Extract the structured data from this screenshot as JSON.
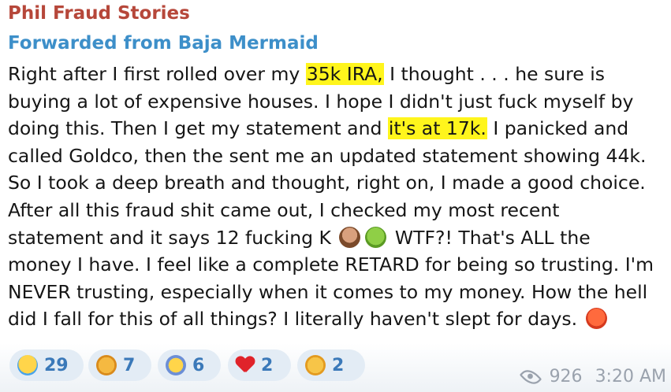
{
  "channel": {
    "name": "Phil Fraud Stories"
  },
  "forwarded_from": "Forwarded from Baja Mermaid",
  "message": {
    "l1_a": "Right after I first rolled over my ",
    "l1_hl": "35k IRA,",
    "l1_b": " I thought . . . he sure is",
    "l2": "buying a lot of expensive houses. I hope I didn't just fuck myself by",
    "l3_a": "doing this. Then I get my statement and ",
    "l3_hl": "it's at 17k.",
    "l3_b": " I panicked and",
    "l4": "called Goldco, then the sent me an updated statement showing 44k.",
    "l5": "So I took a deep breath and thought, right on, I made a good choice.",
    "l6": "After all this fraud shit came out, I checked my most recent",
    "l7_a": "statement and it says 12 fucking K",
    "l7_b": " WTF?! That's ALL the",
    "l8": "money I have. I feel like a complete RETARD for being so trusting. I'm",
    "l9": "NEVER trusting, especially when it comes to my money. How the hell",
    "l10": "did I fall for this of all things? I literally haven't slept for days.",
    "emojis": [
      "facepalm-emoji",
      "sick-emoji",
      "angry-emoji"
    ]
  },
  "reactions": [
    {
      "icon": "crying-face-icon",
      "count": "29"
    },
    {
      "icon": "folded-hands-icon",
      "count": "7"
    },
    {
      "icon": "screaming-face-icon",
      "count": "6"
    },
    {
      "icon": "red-heart-icon",
      "count": "2"
    },
    {
      "icon": "clapping-hands-icon",
      "count": "2"
    }
  ],
  "views": "926",
  "time": "3:20 AM",
  "colors": {
    "channel_name": "#b6473a",
    "forwarded": "#3d8fc9",
    "highlight": "#fff51c",
    "reaction_bg": "#e3ecf5",
    "reaction_count": "#3b79b9",
    "meta": "#9aa2ad"
  }
}
